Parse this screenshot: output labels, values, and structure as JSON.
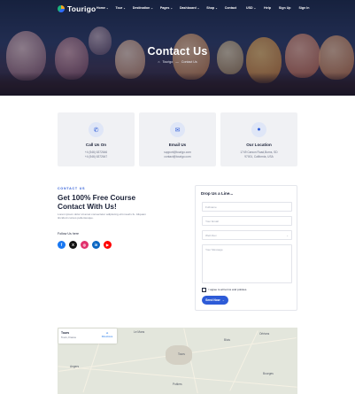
{
  "brand": {
    "name": "Tourigo"
  },
  "nav": {
    "menu": [
      {
        "label": "Home",
        "has_caret": true
      },
      {
        "label": "Tour",
        "has_caret": true
      },
      {
        "label": "Destination",
        "has_caret": true
      },
      {
        "label": "Pages",
        "has_caret": true
      },
      {
        "label": "Dashboard",
        "has_caret": true
      },
      {
        "label": "Shop",
        "has_caret": true
      },
      {
        "label": "Contact",
        "has_caret": false
      }
    ],
    "right": [
      {
        "label": "USD",
        "has_caret": true
      },
      {
        "label": "Help"
      },
      {
        "label": "Sign Up"
      },
      {
        "label": "Sign In"
      }
    ]
  },
  "hero": {
    "title": "Contact Us",
    "breadcrumb": [
      "Tourigo",
      "Contact Us"
    ]
  },
  "cards": [
    {
      "title": "Call Us On",
      "icon": "phone-icon",
      "lines": [
        "+4 (546) 6372646",
        "+4 (546) 6372647"
      ]
    },
    {
      "title": "Email Us",
      "icon": "mail-icon",
      "lines": [
        "support@tourigo.com",
        "contact@tourigo.com"
      ]
    },
    {
      "title": "Our Location",
      "icon": "location-pin-icon",
      "lines": [
        "1749 Carson Road,Burns, SD",
        "97001, California, USA"
      ]
    }
  ],
  "contact_intro": {
    "eyebrow": "CONTACT US",
    "headline": "Get 100% Free Course Contact With Us!",
    "description": "Lorem ipsum dolor sit amet consectetur adipiscing elit mauris fu. Aliquam tincidunt cursus pellentesque.",
    "follow_label": "Follow Us here",
    "socials": [
      {
        "name": "facebook-icon",
        "glyph": "f",
        "color": "#1877f2"
      },
      {
        "name": "x-icon",
        "glyph": "X",
        "color": "#111111"
      },
      {
        "name": "instagram-icon",
        "glyph": "◎",
        "color": "#e1306c"
      },
      {
        "name": "linkedin-icon",
        "glyph": "in",
        "color": "#0a66c2"
      },
      {
        "name": "youtube-icon",
        "glyph": "▶",
        "color": "#ff0000"
      }
    ]
  },
  "form": {
    "title": "Drop Us a Line...",
    "fullname_placeholder": "Fullname",
    "email_placeholder": "Your Email",
    "select_value": "Web Dev",
    "message_placeholder": "Your Message",
    "agree_label": "I agree to all terms and policies.",
    "submit_label": "Send Now",
    "submit_arrow": "→"
  },
  "map": {
    "place_name": "Tours",
    "address": "Tours, France",
    "directions_label": "Directions",
    "labels": [
      "Tours",
      "Blois",
      "Orléans",
      "Le Mans",
      "Poitiers",
      "Angers",
      "Bourges"
    ]
  },
  "colors": {
    "accent": "#2d5bd7",
    "hero_overlay": "#121830",
    "card_bg": "#f0f1f4"
  }
}
